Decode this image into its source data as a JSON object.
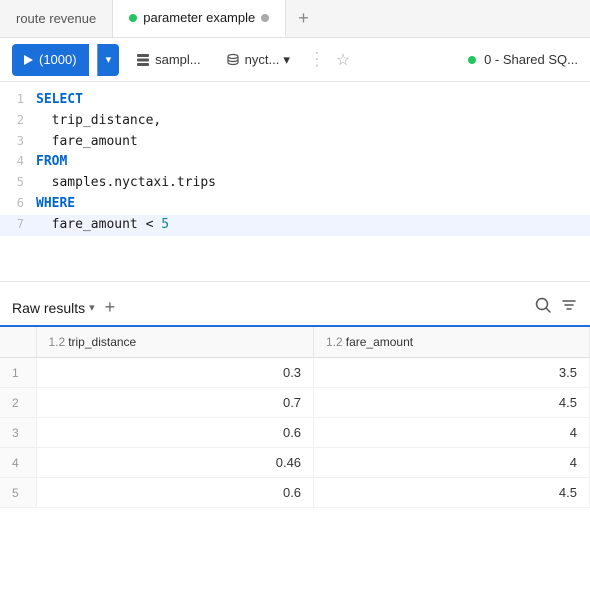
{
  "tabs": [
    {
      "id": "route-revenue",
      "label": "route revenue",
      "active": false,
      "has_dot": false
    },
    {
      "id": "parameter-example",
      "label": "parameter example",
      "active": true,
      "has_dot": true,
      "dot_color": "green"
    }
  ],
  "toolbar": {
    "run_label": "(1000)",
    "dropdown_arrow": "▾",
    "db1": "sampl...",
    "db2": "nyct...",
    "more_icon": "⋮",
    "star_icon": "☆",
    "status_dot_color": "#22c55e",
    "status_text": "0 - Shared SQ..."
  },
  "code_lines": [
    {
      "num": 1,
      "tokens": [
        {
          "t": "kw",
          "v": "SELECT"
        }
      ]
    },
    {
      "num": 2,
      "tokens": [
        {
          "t": "plain",
          "v": "  trip_distance,"
        }
      ]
    },
    {
      "num": 3,
      "tokens": [
        {
          "t": "plain",
          "v": "  fare_amount"
        }
      ]
    },
    {
      "num": 4,
      "tokens": [
        {
          "t": "kw",
          "v": "FROM"
        }
      ]
    },
    {
      "num": 5,
      "tokens": [
        {
          "t": "plain",
          "v": "  samples.nyctaxi.trips"
        }
      ]
    },
    {
      "num": 6,
      "tokens": [
        {
          "t": "kw",
          "v": "WHERE"
        }
      ]
    },
    {
      "num": 7,
      "tokens": [
        {
          "t": "plain",
          "v": "  fare_amount < "
        },
        {
          "t": "num",
          "v": "5"
        }
      ],
      "highlighted": true
    }
  ],
  "results": {
    "label": "Raw results",
    "columns": [
      {
        "type": "1.2",
        "name": "trip_distance"
      },
      {
        "type": "1.2",
        "name": "fare_amount"
      }
    ],
    "rows": [
      {
        "id": 1,
        "trip_distance": "0.3",
        "fare_amount": "3.5"
      },
      {
        "id": 2,
        "trip_distance": "0.7",
        "fare_amount": "4.5"
      },
      {
        "id": 3,
        "trip_distance": "0.6",
        "fare_amount": "4"
      },
      {
        "id": 4,
        "trip_distance": "0.46",
        "fare_amount": "4"
      },
      {
        "id": 5,
        "trip_distance": "0.6",
        "fare_amount": "4.5"
      }
    ]
  }
}
